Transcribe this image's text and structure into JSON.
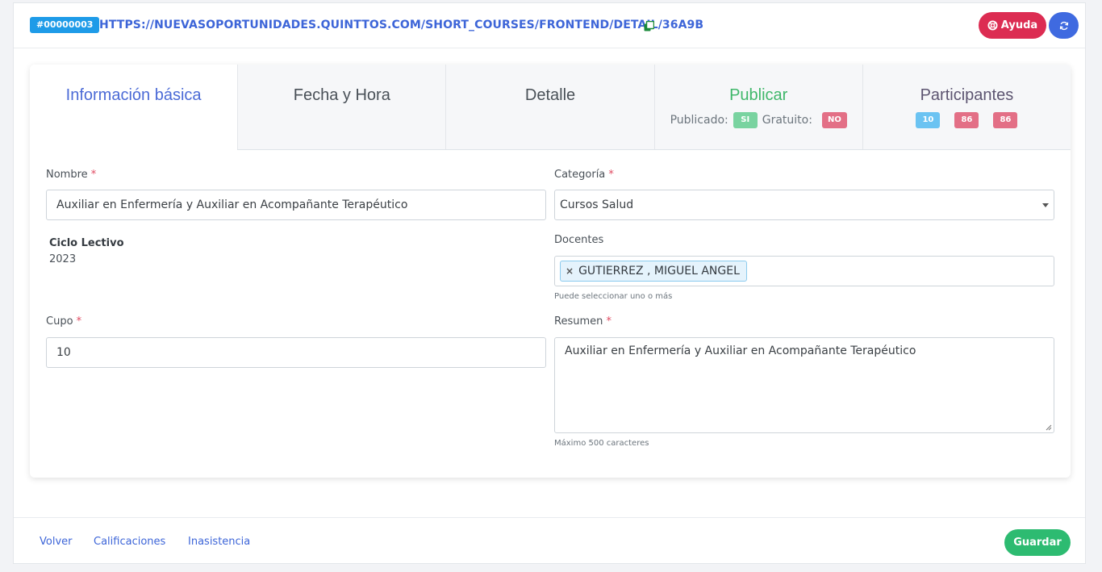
{
  "header": {
    "id_badge": "#00000003",
    "url": "HTTPS://NUEVASOPORTUNIDADES.QUINTTOS.COM/SHORT_COURSES/FRONTEND/DETAIL/36A9B",
    "help_label": "Ayuda"
  },
  "tabs": [
    {
      "label": "Información básica"
    },
    {
      "label": "Fecha y Hora"
    },
    {
      "label": "Detalle"
    },
    {
      "label": "Publicar",
      "published_label": "Publicado:",
      "published_value": "SI",
      "free_label": "Gratuito:",
      "free_value": "NO"
    },
    {
      "label": "Participantes",
      "counts": [
        "10",
        "86",
        "86"
      ]
    }
  ],
  "form": {
    "nombre": {
      "label": "Nombre",
      "value": "Auxiliar en Enfermería y Auxiliar en Acompañante Terapéutico"
    },
    "categoria": {
      "label": "Categoría",
      "value": "Cursos Salud"
    },
    "ciclo": {
      "label": "Ciclo Lectivo",
      "value": "2023"
    },
    "docentes": {
      "label": "Docentes",
      "tag": "GUTIERREZ , MIGUEL ANGEL",
      "help": "Puede seleccionar uno o más"
    },
    "cupo": {
      "label": "Cupo",
      "value": "10"
    },
    "resumen": {
      "label": "Resumen",
      "value": "Auxiliar en Enfermería y Auxiliar en Acompañante Terapéutico",
      "help": "Máximo 500 caracteres"
    }
  },
  "required_mark": "*",
  "footer": {
    "back": "Volver",
    "grades": "Calificaciones",
    "absence": "Inasistencia",
    "save": "Guardar"
  },
  "colors": {
    "primary": "#3d65d8",
    "danger": "#dc2c52",
    "success": "#2dbb71",
    "info": "#1e9be8"
  }
}
